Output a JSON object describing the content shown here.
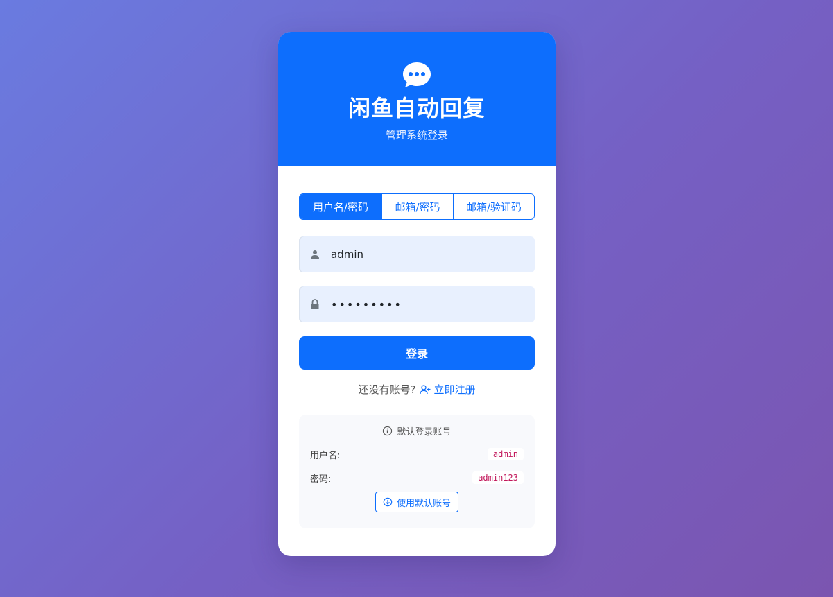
{
  "header": {
    "logo_icon": "chat-bubble-icon",
    "title": "闲鱼自动回复",
    "subtitle": "管理系统登录"
  },
  "tabs": [
    {
      "label": "用户名/密码",
      "active": true
    },
    {
      "label": "邮箱/密码",
      "active": false
    },
    {
      "label": "邮箱/验证码",
      "active": false
    }
  ],
  "form": {
    "username_value": "admin",
    "password_value": "admin1234",
    "login_label": "登录"
  },
  "register": {
    "prompt": "还没有账号?",
    "link_label": "立即注册"
  },
  "default_account": {
    "title": "默认登录账号",
    "username_label": "用户名:",
    "username_value": "admin",
    "password_label": "密码:",
    "password_value": "admin123",
    "use_button_label": "使用默认账号"
  },
  "colors": {
    "primary": "#0d6efd",
    "code": "#c2185b"
  }
}
